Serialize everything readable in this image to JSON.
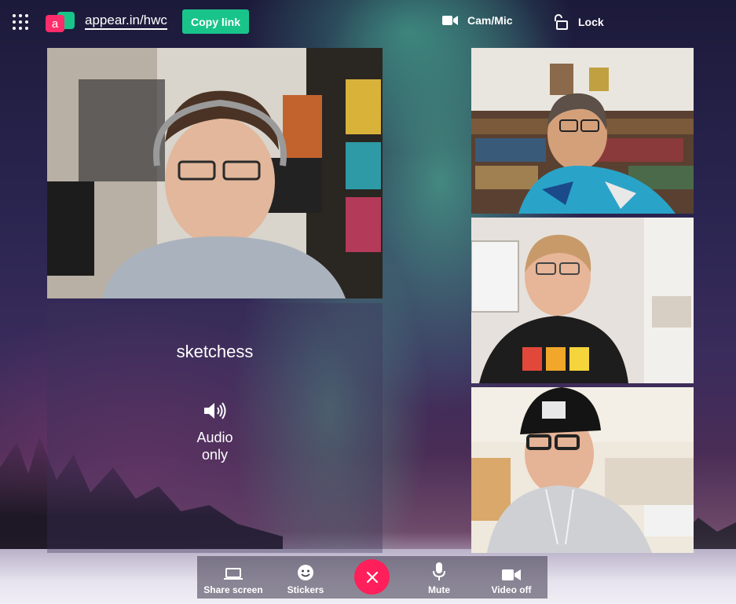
{
  "header": {
    "room_link": "appear.in/hwc",
    "copy_link_label": "Copy link",
    "cam_mic_label": "Cam/Mic",
    "lock_label": "Lock"
  },
  "audio_participant": {
    "name": "sketchess",
    "status": "Audio only"
  },
  "toolbar": {
    "share_screen_label": "Share screen",
    "stickers_label": "Stickers",
    "mute_label": "Mute",
    "video_off_label": "Video off"
  },
  "colors": {
    "accent_green": "#19c48b",
    "leave_red": "#ff1f5a",
    "logo_pink": "#ff2c6b",
    "logo_teal": "#19c48b"
  }
}
